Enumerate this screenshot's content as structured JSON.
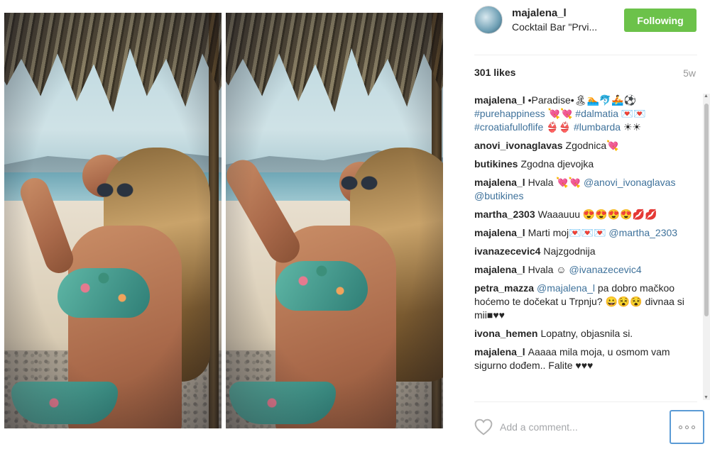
{
  "post": {
    "username": "majalena_l",
    "location": "Cocktail Bar \"Prvi...",
    "follow_label": "Following",
    "likes": "301 likes",
    "age": "5w"
  },
  "comments": [
    {
      "user": "majalena_l",
      "segments": [
        {
          "t": "•Paradise•🏝🏊🐬🚣⚽ "
        },
        {
          "t": "#purehappiness",
          "tag": true
        },
        {
          "t": " 💘💘 "
        },
        {
          "t": "#dalmatia",
          "tag": true
        },
        {
          "t": " 💌💌 "
        },
        {
          "t": "#croatiafulloflife",
          "tag": true
        },
        {
          "t": " 👙👙 "
        },
        {
          "t": "#lumbarda",
          "tag": true
        },
        {
          "t": " ☀☀"
        }
      ]
    },
    {
      "user": "anovi_ivonaglavas",
      "segments": [
        {
          "t": "Zgodnica💘"
        }
      ]
    },
    {
      "user": "butikines",
      "segments": [
        {
          "t": "Zgodna djevojka"
        }
      ]
    },
    {
      "user": "majalena_l",
      "segments": [
        {
          "t": "Hvala 💘💘 "
        },
        {
          "t": "@anovi_ivonaglavas",
          "tag": true
        },
        {
          "t": " "
        },
        {
          "t": "@butikines",
          "tag": true
        }
      ]
    },
    {
      "user": "martha_2303",
      "segments": [
        {
          "t": "Waaauuu 😍😍😍😍💋💋"
        }
      ]
    },
    {
      "user": "majalena_l",
      "segments": [
        {
          "t": "Marti moj💌💌💌 "
        },
        {
          "t": "@martha_2303",
          "tag": true
        }
      ]
    },
    {
      "user": "ivanazecevic4",
      "segments": [
        {
          "t": "Najzgodnija"
        }
      ]
    },
    {
      "user": "majalena_l",
      "segments": [
        {
          "t": "Hvala ☺ "
        },
        {
          "t": "@ivanazecevic4",
          "tag": true
        }
      ]
    },
    {
      "user": "petra_mazza",
      "segments": [
        {
          "t": "@majalena_l",
          "tag": true
        },
        {
          "t": " pa dobro mačkoo hoćemo te dočekat u Trpnju? 😀😵😵 divnaa si mii■♥♥"
        }
      ]
    },
    {
      "user": "ivona_hemen",
      "segments": [
        {
          "t": "Lopatny, objasnila si."
        }
      ]
    },
    {
      "user": "majalena_l",
      "segments": [
        {
          "t": "Aaaaa mila moja, u osmom vam sigurno dođem.. Falite ♥♥♥"
        }
      ]
    }
  ],
  "comment_box": {
    "placeholder": "Add a comment..."
  },
  "icons": {
    "like": "heart-outline-icon",
    "more": "more-options-icon"
  },
  "colors": {
    "follow_button": "#6cc24a",
    "tag_link": "#3f729b",
    "more_button_border": "#5b9bd5"
  }
}
